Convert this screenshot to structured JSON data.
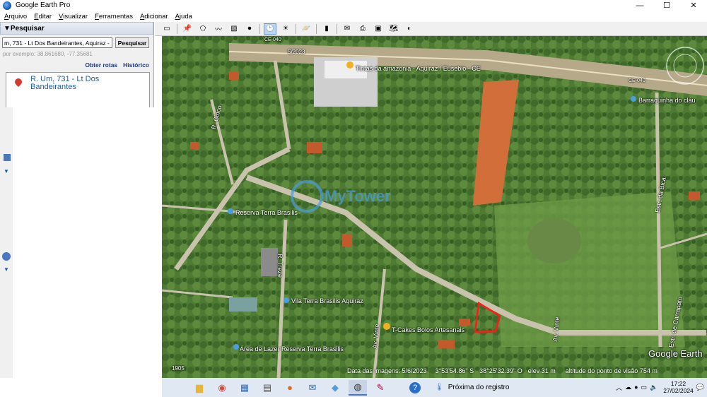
{
  "window": {
    "title": "Google Earth Pro",
    "minimize": "—",
    "maximize": "☐",
    "close": "✕"
  },
  "menu": [
    "Arquivo",
    "Editar",
    "Visualizar",
    "Ferramentas",
    "Adicionar",
    "Ajuda"
  ],
  "search": {
    "header": "▼Pesquisar",
    "query": "m, 731 - Lt Dos Bandeirantes, Aquiraz - CE",
    "button": "Pesquisar",
    "example": "por exemplo: 38.861680, -77.35681",
    "link_routes": "Obter rotas",
    "link_history": "Histórico",
    "result": "R. Um, 731 - Lt Dos Bandeirantes"
  },
  "map_labels": {
    "highway1": "CE-040",
    "highway2": "CE-040",
    "date_tag": "5/2023",
    "poi1": "Tintas da amazonia - Aquiraz / Eusebio - CE",
    "poi2": "Barraquinha do cláu",
    "poi3": "Reserva Terra Brasilis",
    "poi4": "Vila Terra Brasilis Aquiraz",
    "poi5": "T-Cakes Bolos Artesanais",
    "poi6": "Área de Lazer Reserva Terra Brasilis",
    "street1": "R. Cinco",
    "street2": "R. Treze",
    "street3": "Av. Vinte",
    "street4": "Av. Vinte",
    "street5": "Estr. da Bica",
    "street6": "Estr. de Carrapato",
    "watermark": "MyTower",
    "google": "Google Earth",
    "scale": "1905"
  },
  "status": {
    "imagery_date": "Data das imagens: 5/6/2023",
    "lat": "3°53'54.86\" S",
    "lon": "38°25'32.39\" O",
    "elev": "elev   31 m",
    "eye_alt": "altitude do ponto de visão   754 m"
  },
  "taskbar": {
    "weather": "Próxima do registro",
    "time": "17:22",
    "date": "27/02/2024"
  },
  "colors": {
    "boundary": "#ff1a1a",
    "poi_pin": "#f2b01e",
    "accent": "#1a5fb4"
  }
}
